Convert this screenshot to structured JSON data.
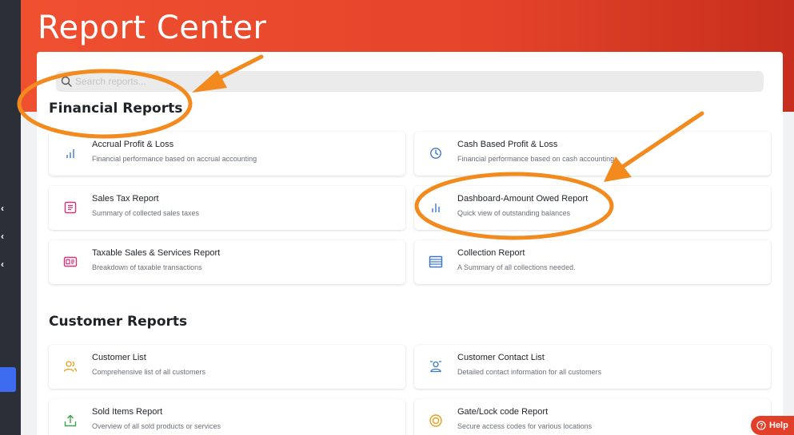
{
  "header": {
    "title": "Report Center"
  },
  "search": {
    "placeholder": "Search reports..."
  },
  "sections": [
    {
      "title": "Financial Reports",
      "cards": [
        {
          "title": "Accrual Profit & Loss",
          "desc": "Financial performance based on accrual accounting",
          "icon": "bar-chart-icon"
        },
        {
          "title": "Cash Based Profit & Loss",
          "desc": "Financial performance based on cash accounting",
          "icon": "clock-icon"
        },
        {
          "title": "Sales Tax Report",
          "desc": "Summary of collected sales taxes",
          "icon": "receipt-icon"
        },
        {
          "title": "Dashboard-Amount Owed Report",
          "desc": "Quick view of outstanding balances",
          "icon": "bar-chart-icon"
        },
        {
          "title": "Taxable Sales & Services Report",
          "desc": "Breakdown of taxable transactions",
          "icon": "id-card-icon"
        },
        {
          "title": "Collection Report",
          "desc": "A Summary of all collections needed.",
          "icon": "list-icon"
        }
      ]
    },
    {
      "title": "Customer Reports",
      "cards": [
        {
          "title": "Customer List",
          "desc": "Comprehensive list of all customers",
          "icon": "users-icon"
        },
        {
          "title": "Customer Contact List",
          "desc": "Detailed contact information for all customers",
          "icon": "contact-icon"
        },
        {
          "title": "Sold Items Report",
          "desc": "Overview of all sold products or services",
          "icon": "upload-box-icon"
        },
        {
          "title": "Gate/Lock code Report",
          "desc": "Secure access codes for various locations",
          "icon": "target-icon"
        }
      ]
    }
  ],
  "help": {
    "label": "Help"
  },
  "colors": {
    "header_accent": "#e4442a",
    "annotation": "#f28a1e",
    "blue_icon": "#3b78c9",
    "pink_icon": "#d6357a",
    "yellow_icon": "#e6a01e",
    "green_icon": "#3fa34d",
    "active_nav": "#3d6cf0"
  }
}
